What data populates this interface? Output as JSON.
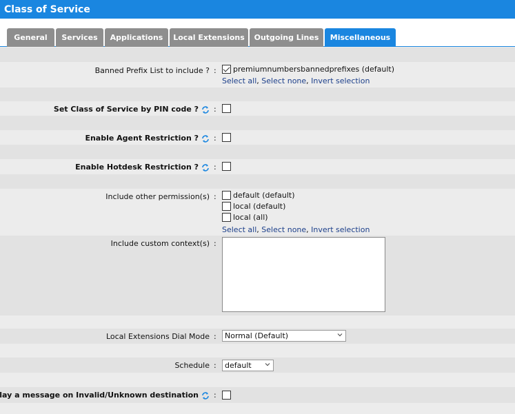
{
  "window": {
    "title": "Class of Service"
  },
  "tabs": [
    {
      "label": "General"
    },
    {
      "label": "Services"
    },
    {
      "label": "Applications"
    },
    {
      "label": "Local Extensions"
    },
    {
      "label": "Outgoing Lines"
    },
    {
      "label": "Miscellaneous",
      "active": true
    }
  ],
  "banned": {
    "label": "Banned Prefix List to include ?",
    "option": "premiumnumbersbannedprefixes (default)",
    "checked": true,
    "select_all": "Select all",
    "select_none": "Select none",
    "invert": "Invert selection"
  },
  "pin": {
    "label": "Set Class of Service by PIN code ?"
  },
  "agent": {
    "label": "Enable Agent Restriction ?"
  },
  "hotdesk": {
    "label": "Enable Hotdesk Restriction ?"
  },
  "permissions": {
    "label": "Include other permission(s)",
    "options": [
      "default (default)",
      "local (default)",
      "local (all)"
    ],
    "select_all": "Select all",
    "select_none": "Select none",
    "invert": "Invert selection"
  },
  "custom_context": {
    "label": "Include custom context(s)",
    "value": ""
  },
  "dial_mode": {
    "label": "Local Extensions Dial Mode",
    "value": "Normal (Default)"
  },
  "schedule": {
    "label": "Schedule",
    "value": "default"
  },
  "invalid_dest": {
    "label": "Play a message on Invalid/Unknown destination"
  },
  "colon": ":",
  "icons": {
    "sync": "sync-icon",
    "dropdown": "chevron-down-icon"
  },
  "colors": {
    "accent": "#1a86e0",
    "tab_inactive": "#8e8e8e",
    "link": "#1c3f8a"
  }
}
